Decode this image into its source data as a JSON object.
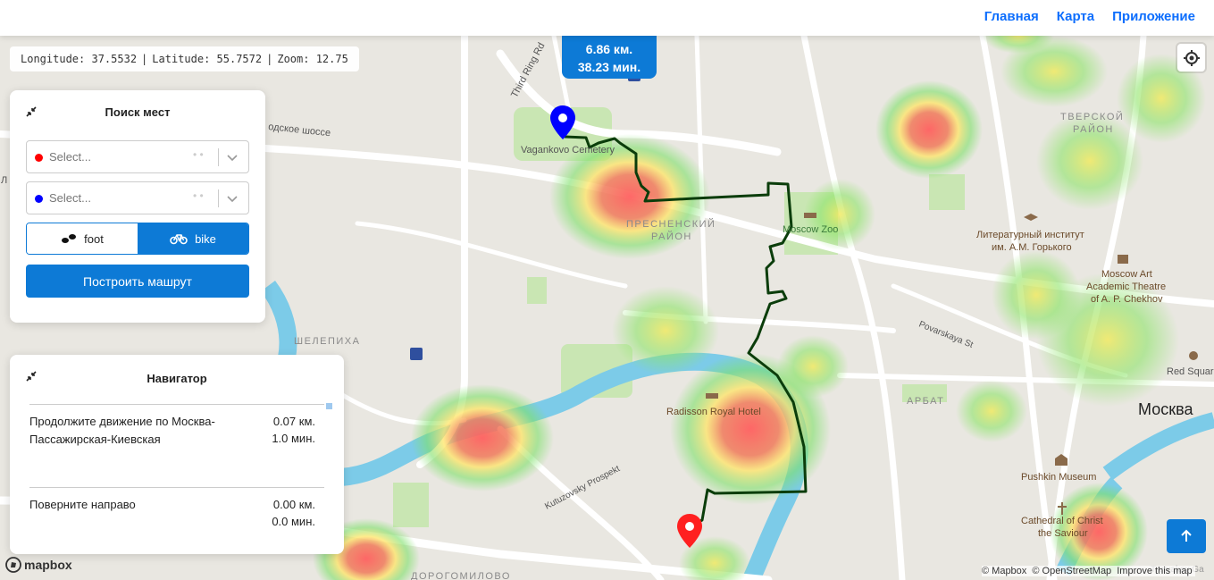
{
  "header": {
    "nav": [
      {
        "label": "Главная"
      },
      {
        "label": "Карта"
      },
      {
        "label": "Приложение"
      }
    ]
  },
  "coords": {
    "longitude": "Longitude: 37.5532",
    "latitude": "Latitude: 55.7572",
    "zoom": "Zoom: 12.75"
  },
  "route_info": {
    "distance": "6.86 км.",
    "time": "38.23 мин."
  },
  "search_panel": {
    "title": "Поиск мест",
    "from_placeholder": "Select...",
    "to_placeholder": "Select...",
    "modes": [
      {
        "label": "foot",
        "selected": false
      },
      {
        "label": "bike",
        "selected": true
      }
    ],
    "build_button": "Построить машрут"
  },
  "navigator": {
    "title": "Навигатор",
    "steps": [
      {
        "text": "Продолжите движение по Москва-Пассажирская-Киевская",
        "distance": "0.07 км.",
        "time": "1.0 мин."
      },
      {
        "text": "Поверните направо",
        "distance": "0.00 км.",
        "time": "0.0 мин."
      }
    ]
  },
  "map_labels": {
    "road_tr": "Third Ring Rd",
    "road_ch": "одское шоссе",
    "vagankovo": "Vagankovo Cemetery",
    "presnya_1": "ПРЕСНЕНСКИЙ",
    "presnya_2": "РАЙОН",
    "zoo": "Moscow Zoo",
    "tver_1": "ТВЕРСКОЙ",
    "tver_2": "РАЙОН",
    "lit_1": "Литературный институт",
    "lit_2": "им. А.М. Горького",
    "mat_1": "Moscow Art",
    "mat_2": "Academic Theatre",
    "mat_3": "of A. P. Chekhov",
    "povarskaya": "Povarskaya St",
    "red_square": "Red Squar",
    "shelepikha": "ШЕЛЕПИХА",
    "radisson": "Radisson Royal Hotel",
    "arbat": "АРБАТ",
    "moskva": "Москва",
    "kutuzovsky": "Kutuzovsky Prospekt",
    "pushkin": "Pushkin Museum",
    "christ_1": "Cathedral of Christ",
    "christ_2": "the Saviour",
    "dorogomilovo": "ДОРОГОМИЛОВО",
    "tretyakov": "Tretyakov Ga",
    "side_l": "Л"
  },
  "attribution": {
    "mapbox": "© Mapbox",
    "osm": "© OpenStreetMap",
    "improve": "Improve this map"
  },
  "mapbox_logo": "mapbox",
  "colors": {
    "accent": "#0d7ad6",
    "route": "#0b3d0b",
    "start_marker": "#0000ff",
    "end_marker": "#ff0000",
    "river": "#7ccbe8"
  }
}
